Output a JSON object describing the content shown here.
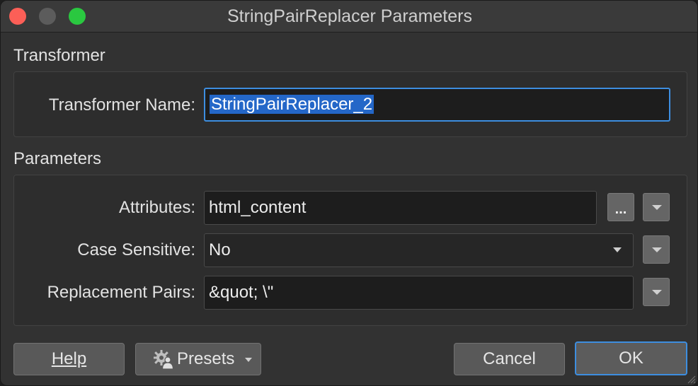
{
  "window": {
    "title": "StringPairReplacer Parameters"
  },
  "transformer_section": {
    "heading": "Transformer",
    "name_label": "Transformer Name:",
    "name_value": "StringPairReplacer_2"
  },
  "parameters_section": {
    "heading": "Parameters",
    "attributes_label": "Attributes:",
    "attributes_value": "html_content",
    "attributes_browse_label": "...",
    "case_sensitive_label": "Case Sensitive:",
    "case_sensitive_value": "No",
    "replacement_pairs_label": "Replacement Pairs:",
    "replacement_pairs_value": "&quot; \\\""
  },
  "footer": {
    "help_label": "Help",
    "presets_label": "Presets",
    "cancel_label": "Cancel",
    "ok_label": "OK"
  },
  "colors": {
    "accent": "#3d8ee0",
    "selection": "#2467c8",
    "close": "#fc5f57",
    "maximize": "#2ac840"
  },
  "icons": {
    "presets": "gear-user-icon",
    "dropdown": "chevron-down-icon"
  }
}
